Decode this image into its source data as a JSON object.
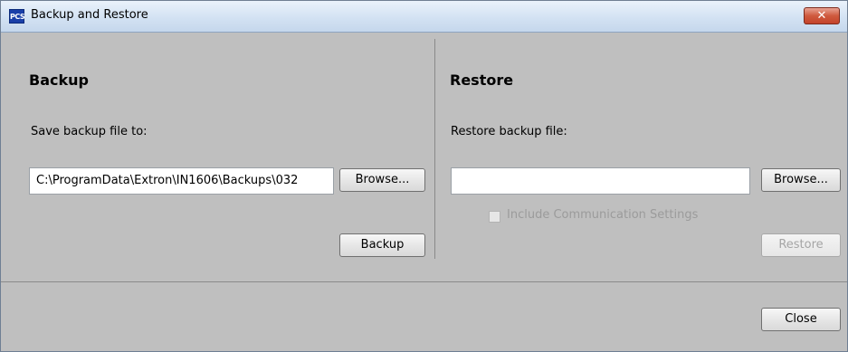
{
  "window": {
    "title": "Backup and Restore",
    "icon_label": "PCS",
    "close_glyph": "✕"
  },
  "backup": {
    "heading": "Backup",
    "save_label": "Save backup file to:",
    "path_value": "C:\\ProgramData\\Extron\\IN1606\\Backups\\032",
    "browse_label": "Browse...",
    "backup_label": "Backup"
  },
  "restore": {
    "heading": "Restore",
    "file_label": "Restore backup file:",
    "path_value": "",
    "browse_label": "Browse...",
    "include_label": "Include Communication Settings",
    "restore_label": "Restore"
  },
  "footer": {
    "close_label": "Close"
  }
}
